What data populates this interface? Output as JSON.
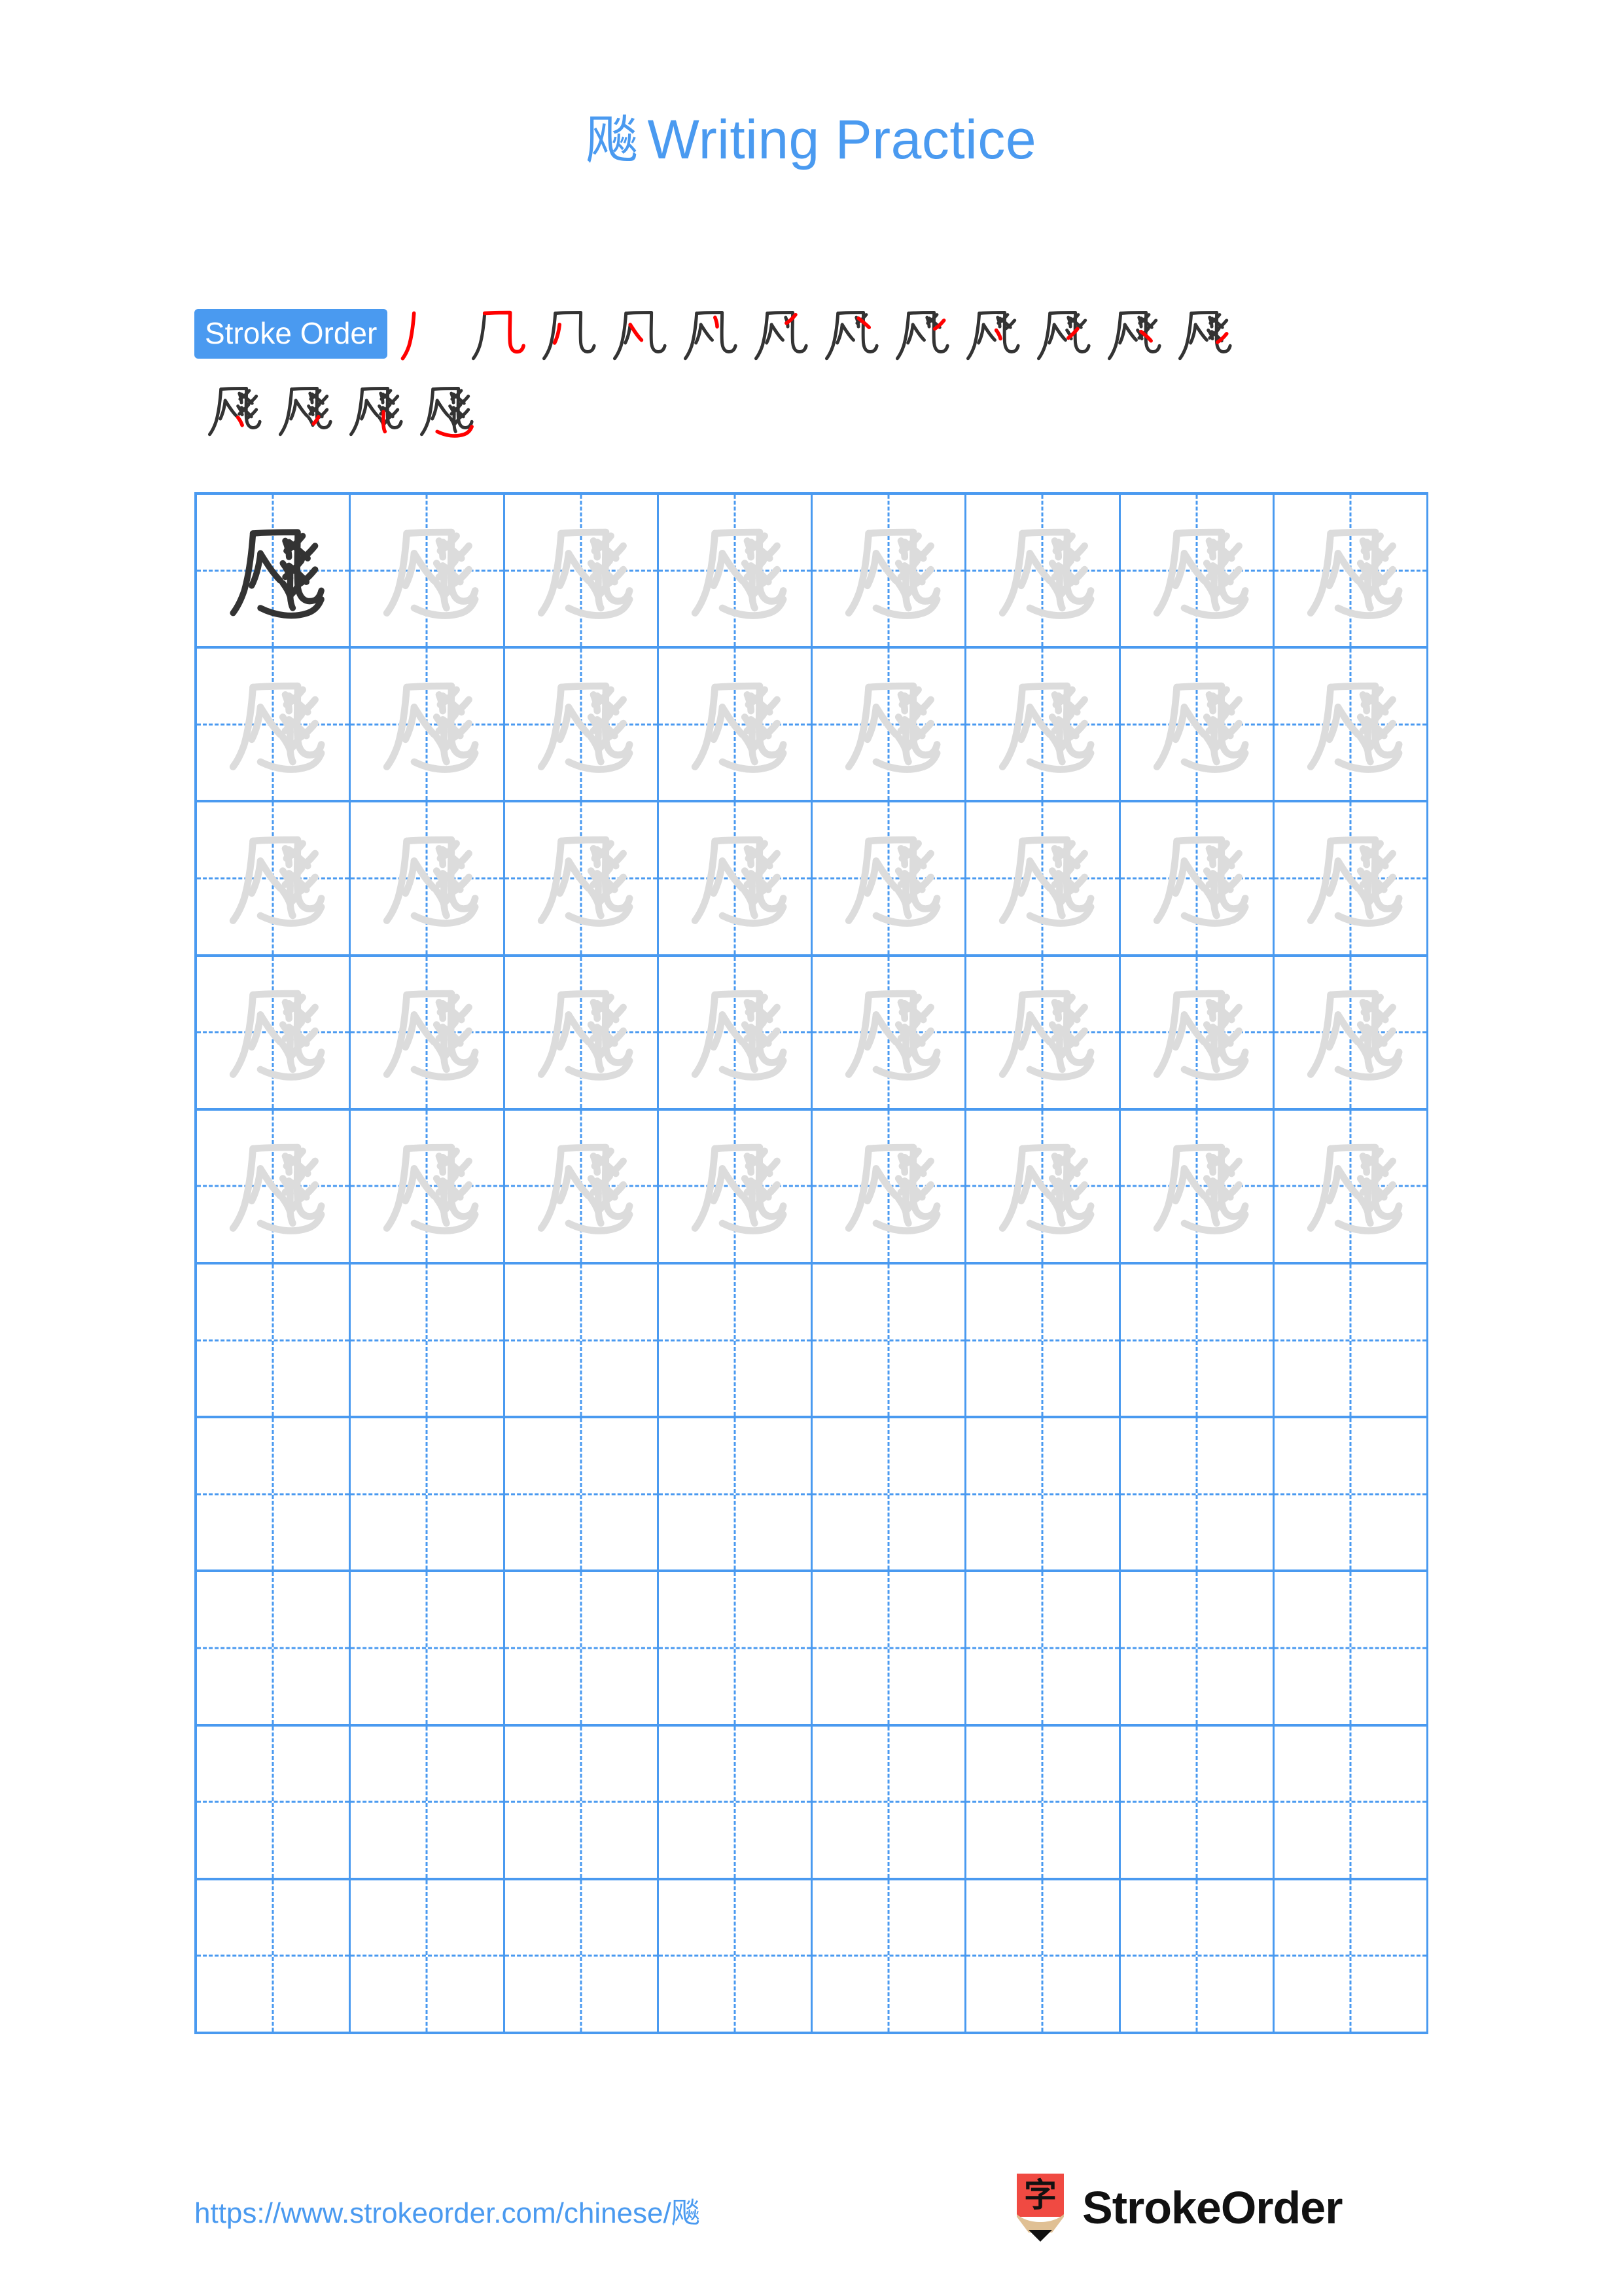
{
  "document": {
    "character": "飚",
    "title_suffix": "Writing Practice",
    "background_color": "#ffffff"
  },
  "colors": {
    "accent_blue": "#4a9af0",
    "grid_line": "#4a9af0",
    "guide_char_gray": "#dcdcdc",
    "ink_black": "#333333",
    "highlight_red": "#ff0000",
    "logo_red": "#f04a42",
    "logo_wood": "#e0c094"
  },
  "stroke_order": {
    "badge_label": "Stroke Order",
    "total_strokes": 16,
    "row1_count": 12,
    "row2_count": 4,
    "description": "Progressive stroke build-up of 飚; the newest stroke of each step is drawn in red."
  },
  "grid": {
    "columns": 8,
    "rows": 10,
    "filled_rows": 5,
    "first_cell_style": "dark-ink-model",
    "traced_cell_style": "light-gray-guide",
    "empty_rows": 5,
    "cell_character": "飚"
  },
  "footer": {
    "url": "https://www.strokeorder.com/chinese/飚",
    "brand_name": "StrokeOrder",
    "logo_glyph": "字"
  }
}
